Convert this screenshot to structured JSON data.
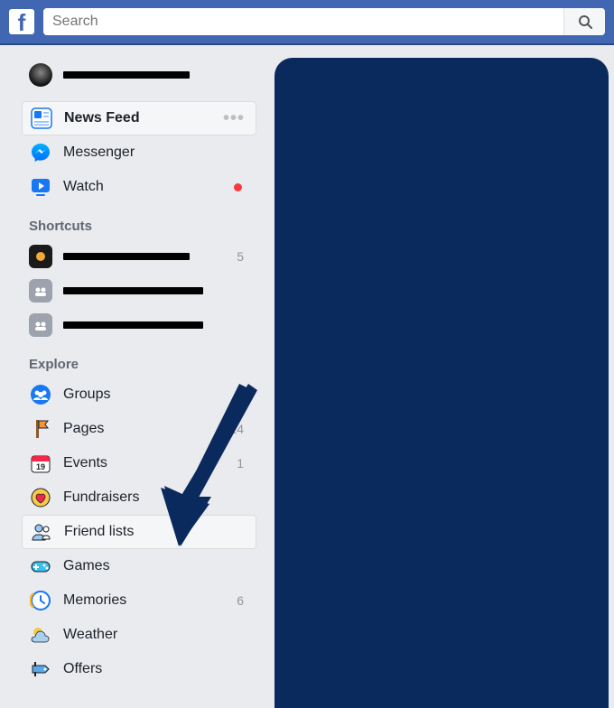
{
  "search": {
    "placeholder": "Search"
  },
  "profile": {
    "name_redacted": true
  },
  "nav": {
    "news_feed": "News Feed",
    "messenger": "Messenger",
    "watch": "Watch"
  },
  "sections": {
    "shortcuts": "Shortcuts",
    "explore": "Explore"
  },
  "shortcuts": [
    {
      "count": "5"
    },
    {
      "count": ""
    },
    {
      "count": ""
    }
  ],
  "explore": {
    "groups": "Groups",
    "pages": "Pages",
    "pages_count": "14",
    "events": "Events",
    "events_count": "1",
    "events_day": "19",
    "fundraisers": "Fundraisers",
    "friend_lists": "Friend lists",
    "games": "Games",
    "memories": "Memories",
    "memories_count": "6",
    "weather": "Weather",
    "offers": "Offers"
  },
  "colors": {
    "brand": "#4267b2",
    "panel": "#0a2a5e"
  }
}
